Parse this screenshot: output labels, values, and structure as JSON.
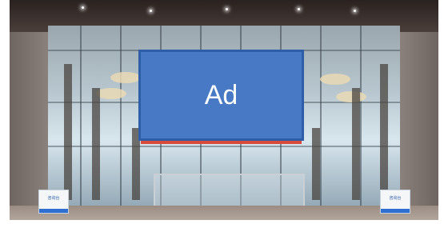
{
  "ad": {
    "label": "Ad",
    "fill": "#4779c4",
    "border": "#2e5ea8"
  },
  "photo": {
    "subject": "glass-curtain-wall-lobby"
  },
  "signs": {
    "left_text": "咨询台",
    "right_text": "咨询台"
  }
}
